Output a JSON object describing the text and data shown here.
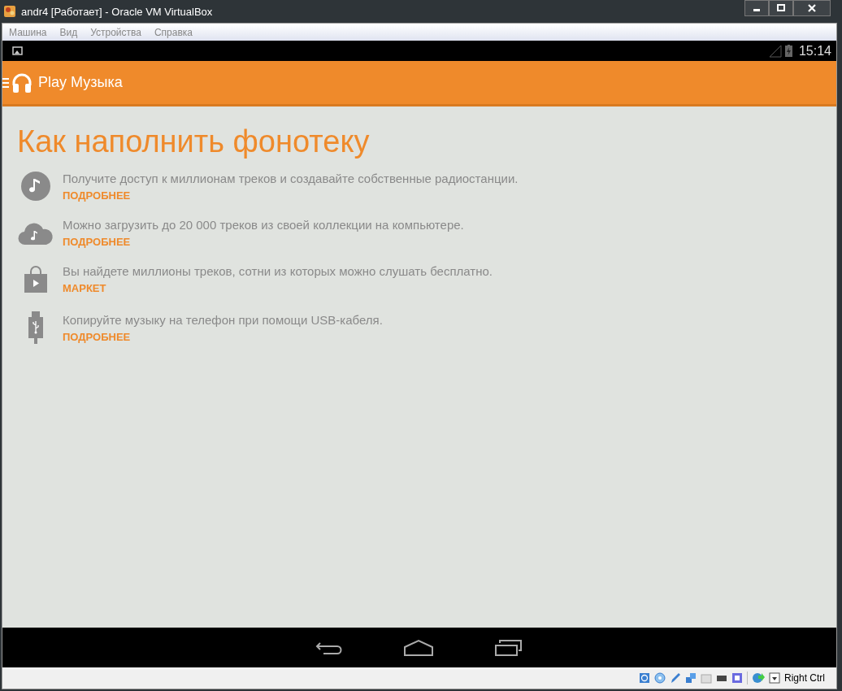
{
  "window": {
    "title": "andr4 [Работает] - Oracle VM VirtualBox"
  },
  "menu": [
    "Машина",
    "Вид",
    "Устройства",
    "Справка"
  ],
  "status_bar": {
    "time": "15:14"
  },
  "app_bar": {
    "title": "Play Музыка"
  },
  "heading": "Как наполнить фонотеку",
  "items": [
    {
      "kind": "music",
      "text": "Получите доступ к миллионам треков и создавайте собственные радиостанции.",
      "link": "ПОДРОБНЕЕ"
    },
    {
      "kind": "cloud",
      "text": "Можно загрузить до 20 000 треков из своей коллекции на компьютере.",
      "link": "ПОДРОБНЕЕ"
    },
    {
      "kind": "store",
      "text": "Вы найдете миллионы треков, сотни из которых можно слушать бесплатно.",
      "link": "МАРКЕТ"
    },
    {
      "kind": "usb",
      "text": "Копируйте музыку на телефон при помощи USB-кабеля.",
      "link": "ПОДРОБНЕЕ"
    }
  ],
  "host_key": "Right Ctrl"
}
